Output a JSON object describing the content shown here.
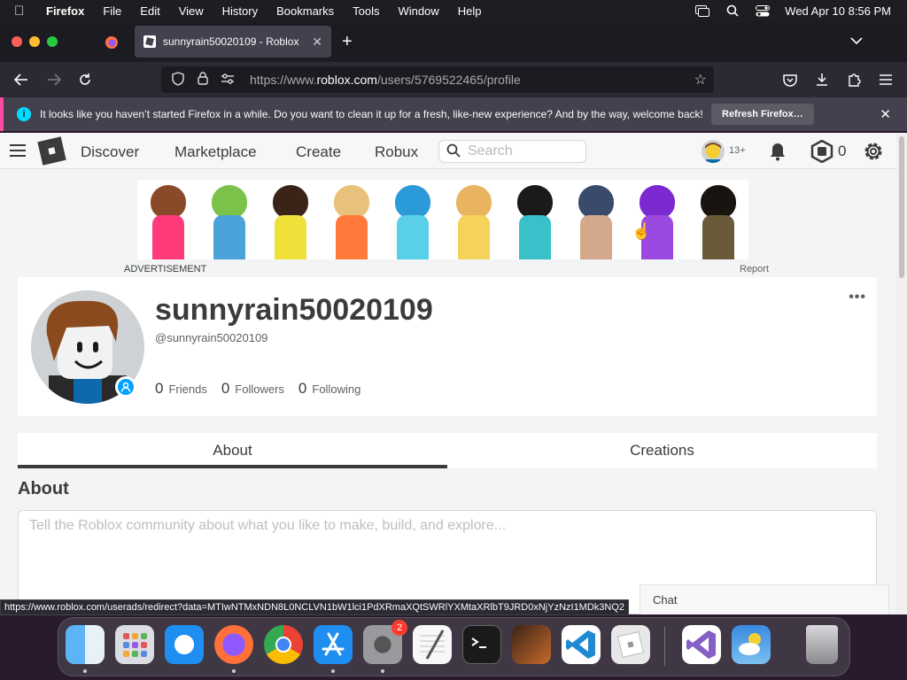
{
  "menubar": {
    "app": "Firefox",
    "items": [
      "File",
      "Edit",
      "View",
      "History",
      "Bookmarks",
      "Tools",
      "Window",
      "Help"
    ],
    "datetime": "Wed Apr 10  8:56 PM"
  },
  "browser": {
    "tab_title": "sunnyrain50020109 - Roblox",
    "url_prefix": "https://www.",
    "url_domain": "roblox.com",
    "url_path": "/users/5769522465/profile",
    "notification": "It looks like you haven’t started Firefox in a while. Do you want to clean it up for a fresh, like-new experience? And by the way, welcome back!",
    "refresh_button": "Refresh Firefox…",
    "status_url": "https://www.roblox.com/userads/redirect?data=MTIwNTMxNDN8L0NCLVN1bW1lci1PdXRmaXQtSWRlYXMtaXRlbT9JRD0xNjYzNzI1MDk3NQ2"
  },
  "roblox": {
    "nav": {
      "discover": "Discover",
      "marketplace": "Marketplace",
      "create": "Create",
      "robux": "Robux"
    },
    "search_placeholder": "Search",
    "age_badge": "13+",
    "robux_count": "0",
    "ad_label": "ADVERTISEMENT",
    "ad_report": "Report",
    "profile": {
      "display_name": "sunnyrain50020109",
      "username": "@sunnyrain50020109",
      "friends_count": "0",
      "friends_label": "Friends",
      "followers_count": "0",
      "followers_label": "Followers",
      "following_count": "0",
      "following_label": "Following"
    },
    "tabs": {
      "about": "About",
      "creations": "Creations"
    },
    "about_title": "About",
    "about_placeholder": "Tell the Roblox community about what you like to make, build, and explore...",
    "chat": "Chat"
  },
  "dock": {
    "apps": [
      "finder-icon",
      "launchpad-icon",
      "safari-icon",
      "firefox-icon",
      "chrome-icon",
      "app-store-icon",
      "system-settings-icon",
      "textedit-icon",
      "terminal-icon",
      "garageband-icon",
      "vscode-icon",
      "roblox-icon",
      "visual-studio-icon",
      "weather-icon",
      "trash-icon"
    ],
    "settings_badge": "2"
  },
  "colors": {
    "roblox_blue": "#00a2ff",
    "firefox_accent": "#ff4aa2",
    "text_dark": "#393b3d"
  }
}
